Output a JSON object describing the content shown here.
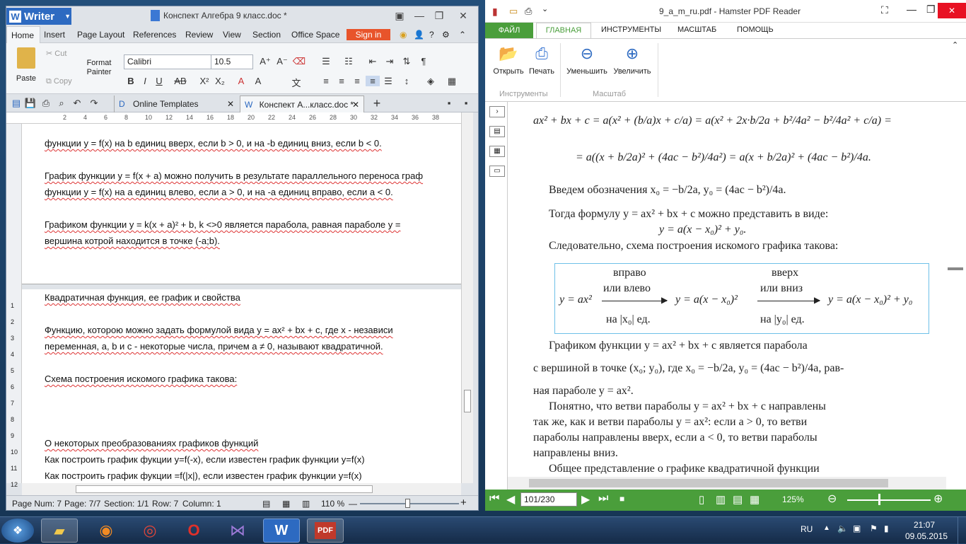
{
  "writer": {
    "app_name": "Writer",
    "title": "Конспект Алгебра 9 класс.doc *",
    "menu": [
      "Home",
      "Insert",
      "Page Layout",
      "References",
      "Review",
      "View",
      "Section",
      "Office Space"
    ],
    "signin": "Sign in",
    "clipboard": {
      "paste": "Paste",
      "cut": "Cut",
      "copy": "Copy",
      "format_painter": "Format Painter"
    },
    "font_name": "Calibri",
    "font_size": "10.5",
    "tabs": {
      "templates": "Online Templates",
      "doc": "Конспект А...класс.doc *"
    },
    "ruler_marks": [
      "2",
      "4",
      "6",
      "8",
      "10",
      "12",
      "14",
      "16",
      "18",
      "20",
      "22",
      "24",
      "26",
      "28",
      "30",
      "32",
      "34",
      "36",
      "38"
    ],
    "vruler_marks": [
      "1",
      "2",
      "3",
      "4",
      "5",
      "6",
      "7",
      "8",
      "9",
      "10",
      "11",
      "12"
    ],
    "page_top_lines": [
      "функции y = f(x) на b единиц вверх, если b > 0, и на -b единиц вниз, если b < 0.",
      "График функции y = f(x + a) можно получить в результате параллельного переноса граф",
      "функции y = f(x) на a единиц влево, если a > 0, и на -a единиц вправо, если a < 0.",
      "Графиком функции y = k(x + a)² + b, k <>0 является парабола, равная параболе y =",
      "вершина котрой находится в точке (-a;b)."
    ],
    "page_bottom_lines": [
      "Квадратичная функция, ее график и свойства",
      "Функцию, которою можно задать формулой вида y = ax² + bx + c, где x - независи",
      "переменная, a, b и c - некоторые числа, причем a ≠ 0, называют квадратичной.",
      "Схема построения искомого графика такова:",
      "О некоторых преобразованиях графиков функций",
      "Как построить график фукции y=f(-x), если известен график функции y=f(x)",
      "Как построить график фукции =f(|x|), если известен график функции y=f(x)"
    ],
    "status": {
      "page_num": "Page Num: 7",
      "page": "Page: 7/7",
      "section": "Section: 1/1",
      "row": "Row: 7",
      "column": "Column: 1",
      "zoom": "110 %"
    }
  },
  "pdf": {
    "title": "9_a_m_ru.pdf - Hamster PDF Reader",
    "tabs": [
      "ФАЙЛ",
      "ГЛАВНАЯ",
      "ИНСТРУМЕНТЫ",
      "МАСШТАБ",
      "ПОМОЩЬ"
    ],
    "buttons": {
      "open": "Открыть",
      "print": "Печать",
      "zoom_out": "Уменьшить",
      "zoom_in": "Увеличить"
    },
    "groups": {
      "tools": "Инструменты",
      "scale": "Масштаб"
    },
    "formula1": "ax² + bx + c = a(x² + (b/a)x + c/a) = a(x² + 2x·b/2a + b²/4a² − b²/4a² + c/a) =",
    "formula2": "= a((x + b/2a)² + (4ac − b²)/4a²) = a(x + b/2a)² + (4ac − b²)/4a.",
    "intro": "Введем обозначения  x₀ = −b/2a,  y₀ = (4ac − b²)/4a.",
    "line_then1": "Тогда формулу y = ax² + bx + c можно представить в виде:",
    "line_then2": "y = a(x − x₀)² + y₀.",
    "line_therefore": "Следовательно, схема построения искомого графика такова:",
    "scheme": {
      "f1": "y = ax²",
      "arrow1_top": "вправо",
      "arrow1_mid": "или влево",
      "arrow1_bot": "на |x₀| ед.",
      "f2": "y = a(x − x₀)²",
      "arrow2_top": "вверх",
      "arrow2_mid": "или вниз",
      "arrow2_bot": "на |y₀| ед.",
      "f3": "y = a(x − x₀)² + y₀"
    },
    "p1a": "Графиком функции y = ax² + bx + c является парабола",
    "p1b": "с вершиной в точке (x₀; y₀), где  x₀ = −b/2a,  y₀ = (4ac − b²)/4a,  рав-",
    "p1c": "ная параболе y = ax².",
    "p2a": "Понятно, что ветви параболы y = ax² + bx + c направлены",
    "p2b": "так же, как и ветви параболы y = ax²: если a > 0, то ветви",
    "p2c": "параболы направлены вверх, если a < 0, то ветви параболы",
    "p2d": "направлены вниз.",
    "p3": "Общее представление о графике квадратичной функции",
    "page_input": "101/230",
    "zoom": "125%"
  },
  "taskbar": {
    "lang": "RU",
    "time": "21:07",
    "date": "09.05.2015"
  }
}
